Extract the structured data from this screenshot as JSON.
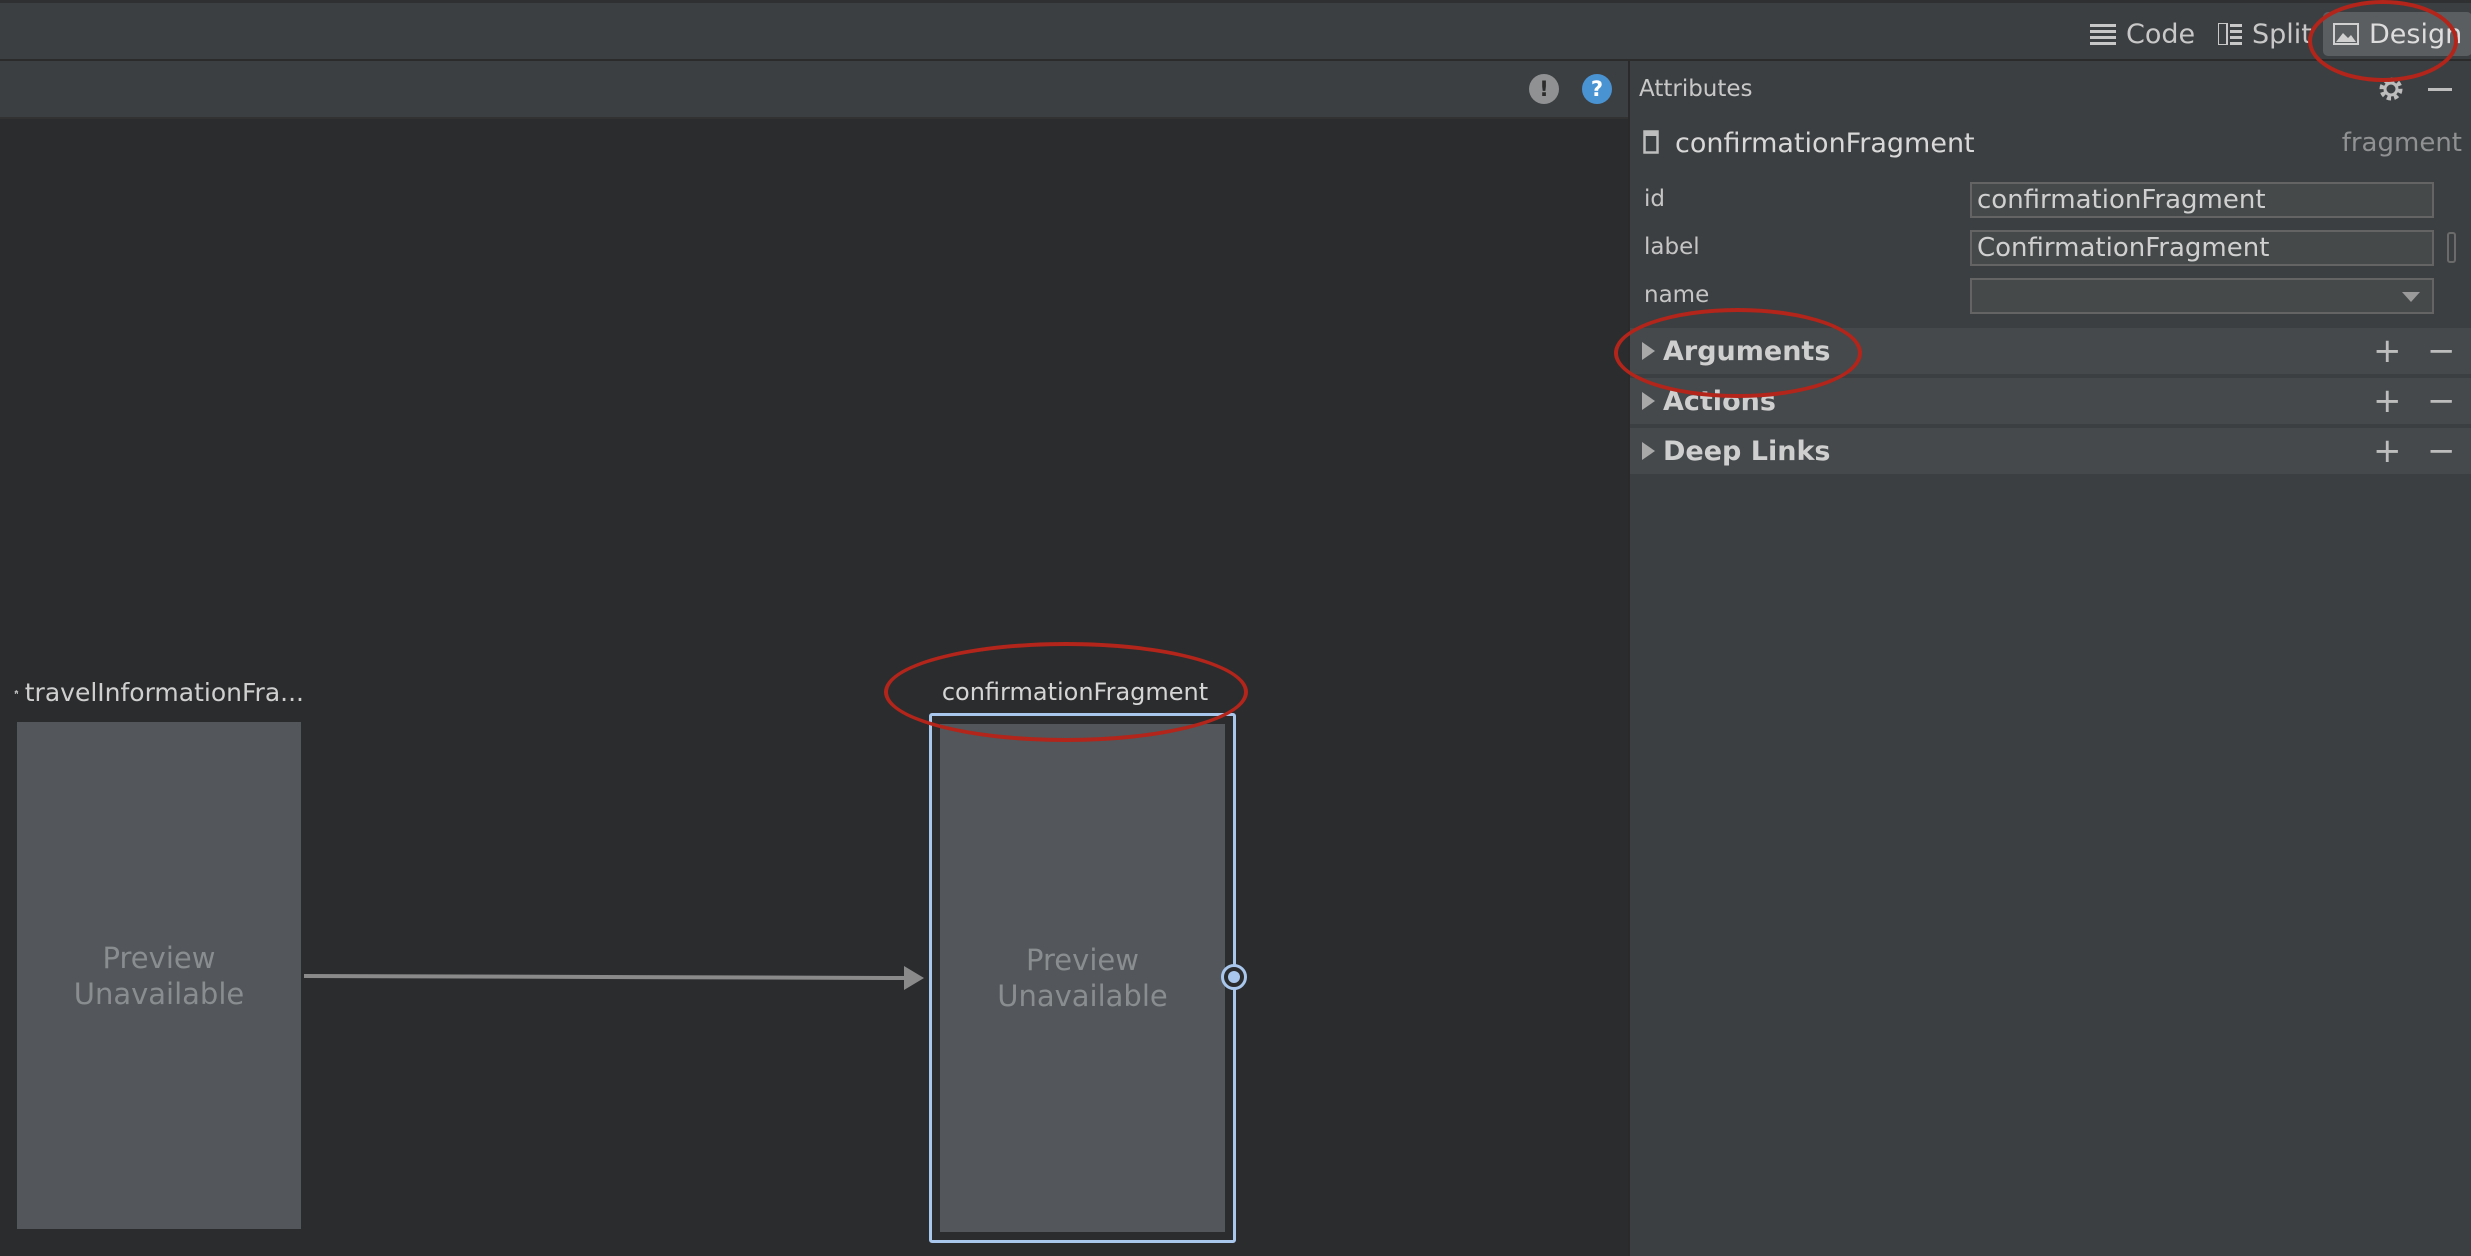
{
  "toolbar": {
    "code_label": "Code",
    "split_label": "Split",
    "design_label": "Design",
    "active_mode": "Design"
  },
  "canvas_header": {
    "warning_icon": "exclamation-circle-icon",
    "help_icon": "question-circle-icon"
  },
  "graph": {
    "start_fragment": {
      "label": "travelInformationFra...",
      "preview_line1": "Preview",
      "preview_line2": "Unavailable",
      "icon": "home-icon"
    },
    "selected_fragment": {
      "label": "confirmationFragment",
      "preview_line1": "Preview",
      "preview_line2": "Unavailable"
    }
  },
  "attributes": {
    "title": "Attributes",
    "element_name": "confirmationFragment",
    "element_type": "fragment",
    "fields": {
      "id_label": "id",
      "id_value": "confirmationFragment",
      "label_label": "label",
      "label_value": "ConfirmationFragment",
      "name_label": "name",
      "name_value": ""
    },
    "sections": [
      {
        "title": "Arguments",
        "add": "+",
        "remove": "−"
      },
      {
        "title": "Actions",
        "add": "+",
        "remove": "−"
      },
      {
        "title": "Deep Links",
        "add": "+",
        "remove": "−"
      }
    ]
  },
  "colors": {
    "annotation": "#b3251a",
    "selection": "#a9c7ec",
    "help_icon": "#4a93d3"
  }
}
